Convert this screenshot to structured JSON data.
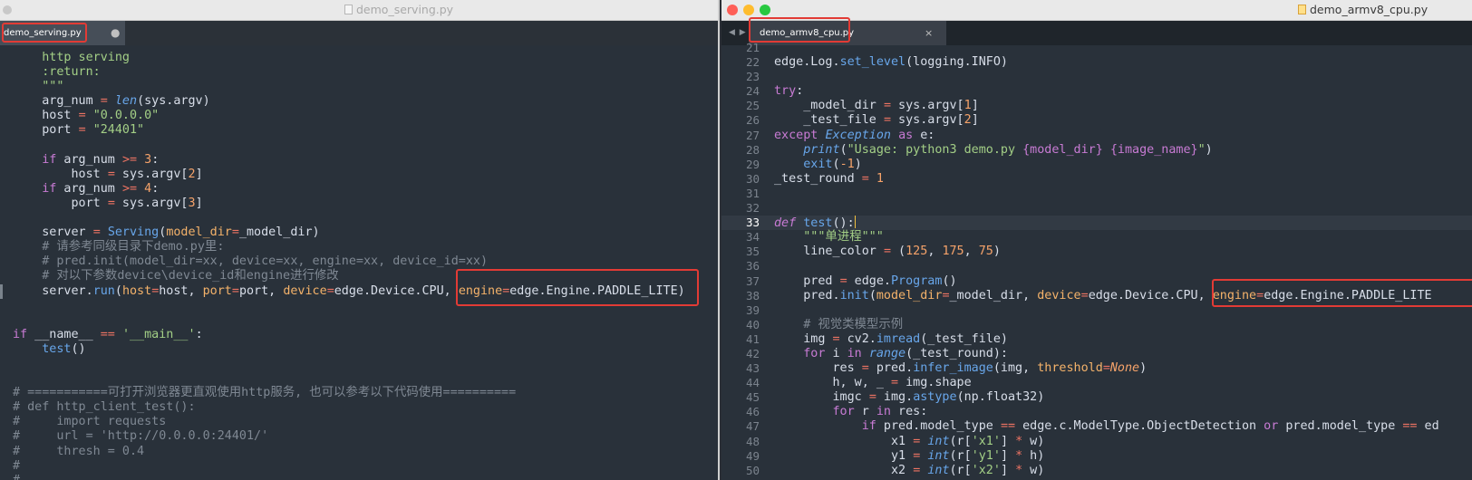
{
  "left_window": {
    "title": "demo_serving.py",
    "tab_label": "demo_serving.py",
    "tab_modified": "●",
    "code_lines": [
      [
        {
          "t": "    http serving",
          "c": "str"
        }
      ],
      [
        {
          "t": "    :return:",
          "c": "str"
        }
      ],
      [
        {
          "t": "    \"\"\"",
          "c": "str"
        }
      ],
      [
        {
          "t": "    arg_num "
        },
        {
          "t": "=",
          "c": "op"
        },
        {
          "t": " "
        },
        {
          "t": "len",
          "c": "fn it"
        },
        {
          "t": "(sys.argv)"
        }
      ],
      [
        {
          "t": "    host "
        },
        {
          "t": "=",
          "c": "op"
        },
        {
          "t": " "
        },
        {
          "t": "\"0.0.0.0\"",
          "c": "str"
        }
      ],
      [
        {
          "t": "    port "
        },
        {
          "t": "=",
          "c": "op"
        },
        {
          "t": " "
        },
        {
          "t": "\"24401\"",
          "c": "str"
        }
      ],
      [
        {
          "t": ""
        }
      ],
      [
        {
          "t": "    "
        },
        {
          "t": "if",
          "c": "kw"
        },
        {
          "t": " arg_num "
        },
        {
          "t": ">=",
          "c": "op"
        },
        {
          "t": " "
        },
        {
          "t": "3",
          "c": "num"
        },
        {
          "t": ":"
        }
      ],
      [
        {
          "t": "        host "
        },
        {
          "t": "=",
          "c": "op"
        },
        {
          "t": " sys.argv["
        },
        {
          "t": "2",
          "c": "num"
        },
        {
          "t": "]"
        }
      ],
      [
        {
          "t": "    "
        },
        {
          "t": "if",
          "c": "kw"
        },
        {
          "t": " arg_num "
        },
        {
          "t": ">=",
          "c": "op"
        },
        {
          "t": " "
        },
        {
          "t": "4",
          "c": "num"
        },
        {
          "t": ":"
        }
      ],
      [
        {
          "t": "        port "
        },
        {
          "t": "=",
          "c": "op"
        },
        {
          "t": " sys.argv["
        },
        {
          "t": "3",
          "c": "num"
        },
        {
          "t": "]"
        }
      ],
      [
        {
          "t": ""
        }
      ],
      [
        {
          "t": "    server "
        },
        {
          "t": "=",
          "c": "op"
        },
        {
          "t": " "
        },
        {
          "t": "Serving",
          "c": "fn"
        },
        {
          "t": "("
        },
        {
          "t": "model_dir",
          "c": "arg"
        },
        {
          "t": "=",
          "c": "op"
        },
        {
          "t": "_model_dir)"
        }
      ],
      [
        {
          "t": "    # 请参考同级目录下demo.py里:",
          "c": "cm"
        }
      ],
      [
        {
          "t": "    # pred.init(model_dir=xx, device=xx, engine=xx, device_id=xx)",
          "c": "cm"
        }
      ],
      [
        {
          "t": "    # 对以下参数device\\device_id和engine进行修改",
          "c": "cm"
        }
      ],
      [
        {
          "t": "    server."
        },
        {
          "t": "run",
          "c": "fn"
        },
        {
          "t": "("
        },
        {
          "t": "host",
          "c": "arg"
        },
        {
          "t": "=",
          "c": "op"
        },
        {
          "t": "host, "
        },
        {
          "t": "port",
          "c": "arg"
        },
        {
          "t": "=",
          "c": "op"
        },
        {
          "t": "port, "
        },
        {
          "t": "device",
          "c": "arg"
        },
        {
          "t": "=",
          "c": "op"
        },
        {
          "t": "edge.Device.CPU, "
        },
        {
          "t": "engine",
          "c": "arg"
        },
        {
          "t": "=",
          "c": "op"
        },
        {
          "t": "edge.Engine.PADDLE_LITE)"
        }
      ],
      [
        {
          "t": ""
        }
      ],
      [
        {
          "t": ""
        }
      ],
      [
        {
          "t": "if",
          "c": "kw"
        },
        {
          "t": " __name__ "
        },
        {
          "t": "==",
          "c": "op"
        },
        {
          "t": " "
        },
        {
          "t": "'__main__'",
          "c": "str"
        },
        {
          "t": ":"
        }
      ],
      [
        {
          "t": "    "
        },
        {
          "t": "test",
          "c": "fn"
        },
        {
          "t": "()"
        }
      ],
      [
        {
          "t": ""
        }
      ],
      [
        {
          "t": ""
        }
      ],
      [
        {
          "t": "# ===========可打开浏览器更直观使用http服务, 也可以参考以下代码使用==========",
          "c": "cm"
        }
      ],
      [
        {
          "t": "# def http_client_test():",
          "c": "cm"
        }
      ],
      [
        {
          "t": "#     import requests",
          "c": "cm"
        }
      ],
      [
        {
          "t": "#     url = 'http://0.0.0.0:24401/'",
          "c": "cm"
        }
      ],
      [
        {
          "t": "#     thresh = 0.4",
          "c": "cm"
        }
      ],
      [
        {
          "t": "#",
          "c": "cm"
        }
      ],
      [
        {
          "t": "#",
          "c": "cm"
        }
      ]
    ]
  },
  "right_window": {
    "title": "demo_armv8_cpu.py",
    "tab_label": "demo_armv8_cpu.py",
    "tab_close": "×",
    "nav_arrows": "◀ ▶",
    "current_line": 33,
    "code_lines": [
      {
        "n": "21",
        "s": [
          {
            "t": ""
          }
        ]
      },
      {
        "n": "22",
        "s": [
          {
            "t": "edge.Log."
          },
          {
            "t": "set_level",
            "c": "fn"
          },
          {
            "t": "(logging.INFO)"
          }
        ]
      },
      {
        "n": "23",
        "s": [
          {
            "t": ""
          }
        ]
      },
      {
        "n": "24",
        "s": [
          {
            "t": "try",
            "c": "kw"
          },
          {
            "t": ":"
          }
        ]
      },
      {
        "n": "25",
        "s": [
          {
            "t": "    _model_dir "
          },
          {
            "t": "=",
            "c": "op"
          },
          {
            "t": " sys.argv["
          },
          {
            "t": "1",
            "c": "num"
          },
          {
            "t": "]"
          }
        ]
      },
      {
        "n": "26",
        "s": [
          {
            "t": "    _test_file "
          },
          {
            "t": "=",
            "c": "op"
          },
          {
            "t": " sys.argv["
          },
          {
            "t": "2",
            "c": "num"
          },
          {
            "t": "]"
          }
        ]
      },
      {
        "n": "27",
        "s": [
          {
            "t": "except",
            "c": "kw"
          },
          {
            "t": " "
          },
          {
            "t": "Exception",
            "c": "fn it"
          },
          {
            "t": " "
          },
          {
            "t": "as",
            "c": "kw"
          },
          {
            "t": " e:"
          }
        ]
      },
      {
        "n": "28",
        "s": [
          {
            "t": "    "
          },
          {
            "t": "print",
            "c": "fn it"
          },
          {
            "t": "("
          },
          {
            "t": "\"Usage: python3 demo.py ",
            "c": "str"
          },
          {
            "t": "{model_dir}",
            "c": "kw"
          },
          {
            "t": " ",
            "c": "str"
          },
          {
            "t": "{image_name}",
            "c": "kw"
          },
          {
            "t": "\"",
            "c": "str"
          },
          {
            "t": ")"
          }
        ]
      },
      {
        "n": "29",
        "s": [
          {
            "t": "    "
          },
          {
            "t": "exit",
            "c": "fn"
          },
          {
            "t": "("
          },
          {
            "t": "-1",
            "c": "num"
          },
          {
            "t": ")"
          }
        ]
      },
      {
        "n": "30",
        "s": [
          {
            "t": "_test_round "
          },
          {
            "t": "=",
            "c": "op"
          },
          {
            "t": " "
          },
          {
            "t": "1",
            "c": "num"
          }
        ]
      },
      {
        "n": "31",
        "s": [
          {
            "t": ""
          }
        ]
      },
      {
        "n": "32",
        "s": [
          {
            "t": ""
          }
        ]
      },
      {
        "n": "33",
        "s": [
          {
            "t": "def",
            "c": "kw it"
          },
          {
            "t": " "
          },
          {
            "t": "test",
            "c": "fn"
          },
          {
            "t": "():"
          }
        ]
      },
      {
        "n": "34",
        "s": [
          {
            "t": "    \"\"\"单进程\"\"\"",
            "c": "str"
          }
        ]
      },
      {
        "n": "35",
        "s": [
          {
            "t": "    line_color "
          },
          {
            "t": "=",
            "c": "op"
          },
          {
            "t": " ("
          },
          {
            "t": "125",
            "c": "num"
          },
          {
            "t": ", "
          },
          {
            "t": "175",
            "c": "num"
          },
          {
            "t": ", "
          },
          {
            "t": "75",
            "c": "num"
          },
          {
            "t": ")"
          }
        ]
      },
      {
        "n": "36",
        "s": [
          {
            "t": ""
          }
        ]
      },
      {
        "n": "37",
        "s": [
          {
            "t": "    pred "
          },
          {
            "t": "=",
            "c": "op"
          },
          {
            "t": " edge."
          },
          {
            "t": "Program",
            "c": "fn"
          },
          {
            "t": "()"
          }
        ]
      },
      {
        "n": "38",
        "s": [
          {
            "t": "    pred."
          },
          {
            "t": "init",
            "c": "fn"
          },
          {
            "t": "("
          },
          {
            "t": "model_dir",
            "c": "arg"
          },
          {
            "t": "=",
            "c": "op"
          },
          {
            "t": "_model_dir, "
          },
          {
            "t": "device",
            "c": "arg"
          },
          {
            "t": "=",
            "c": "op"
          },
          {
            "t": "edge.Device.CPU, "
          },
          {
            "t": "engine",
            "c": "arg"
          },
          {
            "t": "=",
            "c": "op"
          },
          {
            "t": "edge.Engine.PADDLE_LITE"
          }
        ]
      },
      {
        "n": "39",
        "s": [
          {
            "t": ""
          }
        ]
      },
      {
        "n": "40",
        "s": [
          {
            "t": "    # 视觉类模型示例",
            "c": "cm"
          }
        ]
      },
      {
        "n": "41",
        "s": [
          {
            "t": "    img "
          },
          {
            "t": "=",
            "c": "op"
          },
          {
            "t": " cv2."
          },
          {
            "t": "imread",
            "c": "fn"
          },
          {
            "t": "(_test_file)"
          }
        ]
      },
      {
        "n": "42",
        "s": [
          {
            "t": "    "
          },
          {
            "t": "for",
            "c": "kw"
          },
          {
            "t": " i "
          },
          {
            "t": "in",
            "c": "kw"
          },
          {
            "t": " "
          },
          {
            "t": "range",
            "c": "fn it"
          },
          {
            "t": "(_test_round):"
          }
        ]
      },
      {
        "n": "43",
        "s": [
          {
            "t": "        res "
          },
          {
            "t": "=",
            "c": "op"
          },
          {
            "t": " pred."
          },
          {
            "t": "infer_image",
            "c": "fn"
          },
          {
            "t": "(img, "
          },
          {
            "t": "threshold",
            "c": "arg"
          },
          {
            "t": "=",
            "c": "op"
          },
          {
            "t": "None",
            "c": "num it"
          },
          {
            "t": ")"
          }
        ]
      },
      {
        "n": "44",
        "s": [
          {
            "t": "        h, w, _ "
          },
          {
            "t": "=",
            "c": "op"
          },
          {
            "t": " img.shape"
          }
        ]
      },
      {
        "n": "45",
        "s": [
          {
            "t": "        imgc "
          },
          {
            "t": "=",
            "c": "op"
          },
          {
            "t": " img."
          },
          {
            "t": "astype",
            "c": "fn"
          },
          {
            "t": "(np.float32)"
          }
        ]
      },
      {
        "n": "46",
        "s": [
          {
            "t": "        "
          },
          {
            "t": "for",
            "c": "kw"
          },
          {
            "t": " r "
          },
          {
            "t": "in",
            "c": "kw"
          },
          {
            "t": " res:"
          }
        ]
      },
      {
        "n": "47",
        "s": [
          {
            "t": "            "
          },
          {
            "t": "if",
            "c": "kw"
          },
          {
            "t": " pred.model_type "
          },
          {
            "t": "==",
            "c": "op"
          },
          {
            "t": " edge.c.ModelType.ObjectDetection "
          },
          {
            "t": "or",
            "c": "kw"
          },
          {
            "t": " pred.model_type "
          },
          {
            "t": "==",
            "c": "op"
          },
          {
            "t": " ed"
          }
        ]
      },
      {
        "n": "48",
        "s": [
          {
            "t": "                x1 "
          },
          {
            "t": "=",
            "c": "op"
          },
          {
            "t": " "
          },
          {
            "t": "int",
            "c": "fn it"
          },
          {
            "t": "(r["
          },
          {
            "t": "'x1'",
            "c": "str"
          },
          {
            "t": "] "
          },
          {
            "t": "*",
            "c": "op"
          },
          {
            "t": " w)"
          }
        ]
      },
      {
        "n": "49",
        "s": [
          {
            "t": "                y1 "
          },
          {
            "t": "=",
            "c": "op"
          },
          {
            "t": " "
          },
          {
            "t": "int",
            "c": "fn it"
          },
          {
            "t": "(r["
          },
          {
            "t": "'y1'",
            "c": "str"
          },
          {
            "t": "] "
          },
          {
            "t": "*",
            "c": "op"
          },
          {
            "t": " h)"
          }
        ]
      },
      {
        "n": "50",
        "s": [
          {
            "t": "                x2 "
          },
          {
            "t": "=",
            "c": "op"
          },
          {
            "t": " "
          },
          {
            "t": "int",
            "c": "fn it"
          },
          {
            "t": "(r["
          },
          {
            "t": "'x2'",
            "c": "str"
          },
          {
            "t": "] "
          },
          {
            "t": "*",
            "c": "op"
          },
          {
            "t": " w)"
          }
        ]
      }
    ]
  },
  "colors": {
    "editor_bg": "#29313a",
    "highlight_box": "#e23b35"
  }
}
